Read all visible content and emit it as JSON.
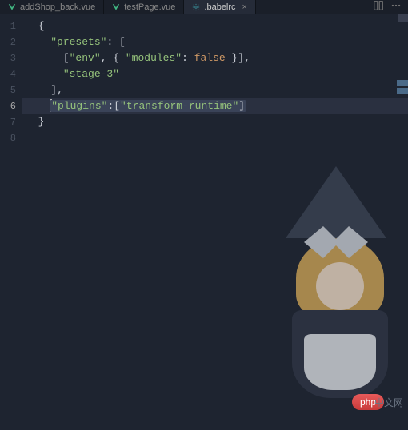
{
  "tabs": [
    {
      "label": "addShop_back.vue",
      "type": "vue",
      "active": false
    },
    {
      "label": "testPage.vue",
      "type": "vue",
      "active": false
    },
    {
      "label": ".babelrc",
      "type": "babel",
      "active": true
    }
  ],
  "code": {
    "lines": [
      {
        "no": "1",
        "indent": "  ",
        "tokens": [
          {
            "c": "p",
            "t": "{"
          }
        ]
      },
      {
        "no": "2",
        "indent": "    ",
        "tokens": [
          {
            "c": "k",
            "t": "\"presets\""
          },
          {
            "c": "p",
            "t": ": ["
          }
        ]
      },
      {
        "no": "3",
        "indent": "      ",
        "tokens": [
          {
            "c": "p",
            "t": "["
          },
          {
            "c": "k",
            "t": "\"env\""
          },
          {
            "c": "p",
            "t": ", { "
          },
          {
            "c": "k",
            "t": "\"modules\""
          },
          {
            "c": "p",
            "t": ": "
          },
          {
            "c": "v",
            "t": "false"
          },
          {
            "c": "p",
            "t": " }],"
          }
        ]
      },
      {
        "no": "4",
        "indent": "      ",
        "tokens": [
          {
            "c": "k",
            "t": "\"stage-3\""
          }
        ]
      },
      {
        "no": "5",
        "indent": "    ",
        "tokens": [
          {
            "c": "p",
            "t": "],"
          }
        ]
      },
      {
        "no": "6",
        "indent": "    ",
        "active": true,
        "selected": true,
        "tokens": [
          {
            "c": "k",
            "t": "\"plugins\""
          },
          {
            "c": "p",
            "t": ":["
          },
          {
            "c": "k",
            "t": "\"transform-runtime\""
          },
          {
            "c": "p",
            "t": "]"
          }
        ]
      },
      {
        "no": "7",
        "indent": "  ",
        "tokens": [
          {
            "c": "p",
            "t": "}"
          }
        ]
      },
      {
        "no": "8",
        "indent": "",
        "tokens": []
      }
    ]
  },
  "watermark": {
    "badge": "php",
    "text": "中文网"
  }
}
